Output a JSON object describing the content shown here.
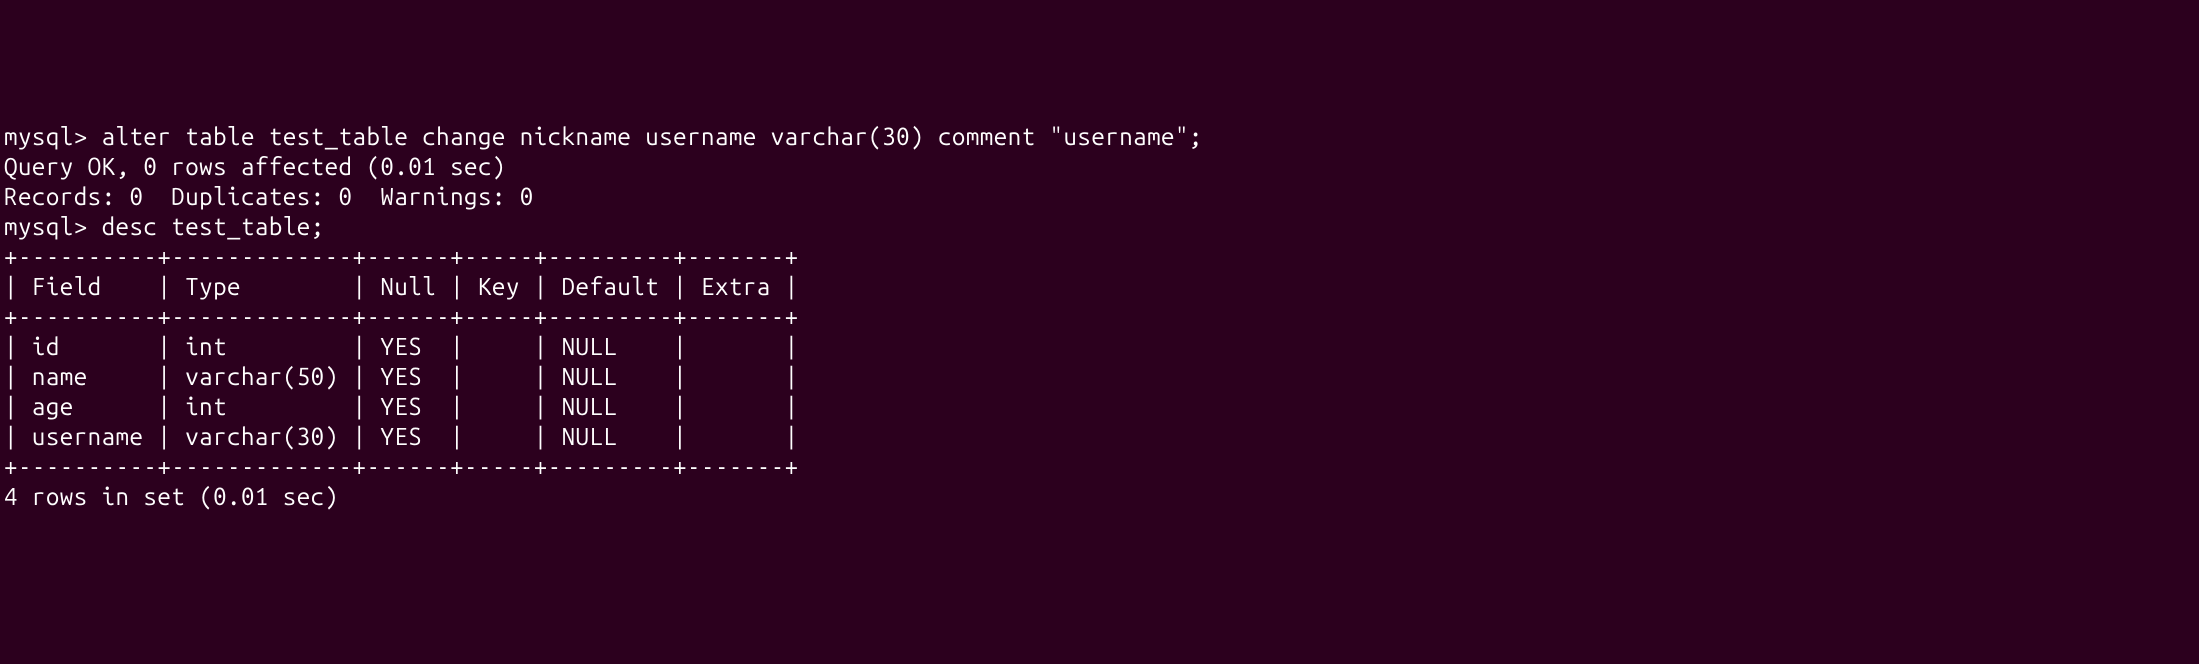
{
  "session": {
    "prompt1": "mysql> ",
    "command1": "alter table test_table change nickname username varchar(30) comment \"username\";",
    "result1_line1": "Query OK, 0 rows affected (0.01 sec)",
    "result1_line2": "Records: 0  Duplicates: 0  Warnings: 0",
    "blank": "",
    "prompt2": "mysql> ",
    "command2": "desc test_table;",
    "table": {
      "border_top": "+----------+-------------+------+-----+---------+-------+",
      "header": "| Field    | Type        | Null | Key | Default | Extra |",
      "border_mid": "+----------+-------------+------+-----+---------+-------+",
      "row1": "| id       | int         | YES  |     | NULL    |       |",
      "row2": "| name     | varchar(50) | YES  |     | NULL    |       |",
      "row3": "| age      | int         | YES  |     | NULL    |       |",
      "row4": "| username | varchar(30) | YES  |     | NULL    |       |",
      "border_bottom": "+----------+-------------+------+-----+---------+-------+"
    },
    "footer": "4 rows in set (0.01 sec)"
  },
  "chart_data": {
    "type": "table",
    "title": "desc test_table",
    "columns": [
      "Field",
      "Type",
      "Null",
      "Key",
      "Default",
      "Extra"
    ],
    "rows": [
      {
        "Field": "id",
        "Type": "int",
        "Null": "YES",
        "Key": "",
        "Default": "NULL",
        "Extra": ""
      },
      {
        "Field": "name",
        "Type": "varchar(50)",
        "Null": "YES",
        "Key": "",
        "Default": "NULL",
        "Extra": ""
      },
      {
        "Field": "age",
        "Type": "int",
        "Null": "YES",
        "Key": "",
        "Default": "NULL",
        "Extra": ""
      },
      {
        "Field": "username",
        "Type": "varchar(30)",
        "Null": "YES",
        "Key": "",
        "Default": "NULL",
        "Extra": ""
      }
    ]
  }
}
